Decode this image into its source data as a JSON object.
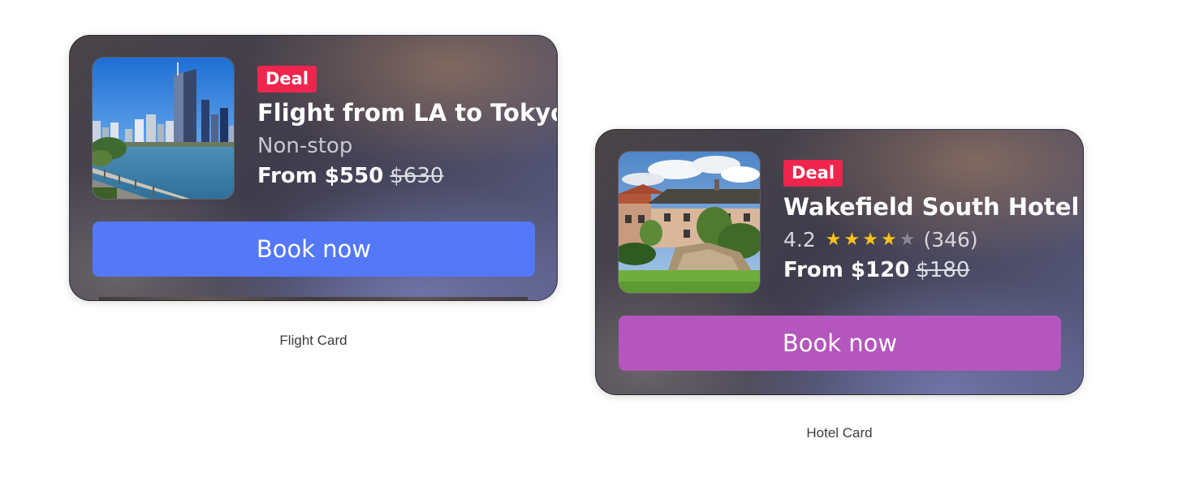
{
  "flight_card": {
    "badge": "Deal",
    "title": "Flight from LA to Tokyo",
    "subtitle": "Non-stop",
    "price": "From $550",
    "original_price": "$630",
    "button_label": "Book now",
    "button_color": "#5478f7",
    "caption": "Flight Card"
  },
  "hotel_card": {
    "badge": "Deal",
    "title": "Wakefield South Hotel",
    "rating": "4.2",
    "rating_value": 4,
    "rating_max": 5,
    "review_count": "(346)",
    "price": "From $120",
    "original_price": "$180",
    "button_label": "Book now",
    "button_color": "#b556be",
    "caption": "Hotel Card"
  },
  "colors": {
    "badge": "#f0254e",
    "star_on": "#f7c21a",
    "star_off": "#8a8794"
  }
}
